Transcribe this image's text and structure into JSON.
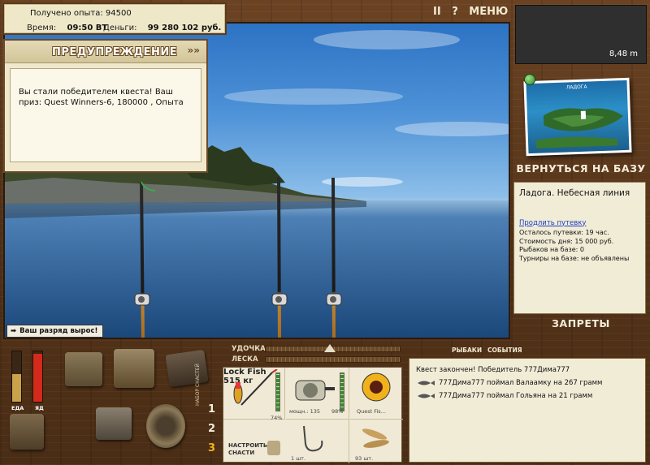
{
  "stats": {
    "experience_text": "Получено опыта: 94500",
    "time_label": "Время:",
    "time_value": "09:50 ВТ",
    "money_label": "Деньги:",
    "money_value": "99 280 102 руб."
  },
  "warning": {
    "title": "ПРЕДУПРЕЖДЕНИЕ",
    "arrows": "»»",
    "message": "Вы стали победителем квеста! Ваш приз: Quest Winners-6, 180000 , Опыта"
  },
  "top_controls": {
    "pause": "II",
    "help": "?",
    "menu": "МЕНЮ"
  },
  "depth": {
    "value": "8,48 m"
  },
  "map_card": {
    "caption": "ЛАДОГА"
  },
  "sidebar": {
    "back_to_base": "ВЕРНУТЬСЯ НА БАЗУ",
    "location_name": "Ладога. Небесная линия",
    "extend_link": "Продлить путевку",
    "remaining": "Осталось путевки: 19 час.",
    "day_cost": "Стоимость дня: 15 000 руб.",
    "anglers": "Рыбаков на базе: 0",
    "tournaments": "Турниры на базе: не объявлены",
    "bans": "ЗАПРЕТЫ"
  },
  "rank_banner": "Ваш разряд вырос!",
  "tension": {
    "rod_label": "УДОЧКА",
    "line_label": "ЛЕСКА"
  },
  "tabs": {
    "anglers": "РЫБАКИ",
    "events": "СОБЫТИЯ"
  },
  "gauges": {
    "food_label": "ЕДА",
    "poison_label": "ЯД",
    "food_level": 0.55,
    "poison_level": 0.95,
    "food_color": "#c9a24a",
    "poison_color": "#d42a1c"
  },
  "sets": {
    "one": "1",
    "two": "2",
    "three": "3",
    "label": "НАБОР СНАСТЕЙ"
  },
  "tackle": {
    "rod_name": "Lock Fish",
    "rod_weight": "515 кг",
    "rod_percent": "74%",
    "reel_power": "мощн.: 135",
    "reel_percent": "98%",
    "line_name": "Quest Fis...",
    "configure_label": "НАСТРОИТЬ СНАСТИ",
    "hook_count": "1 шт.",
    "bait_count": "93 шт."
  },
  "events": [
    "Квест закончен! Победитель 777Дима777",
    "777Дима777 поймал Валаамку на 267 грамм",
    "777Дима777 поймал Гольяна на 21 грамм"
  ]
}
